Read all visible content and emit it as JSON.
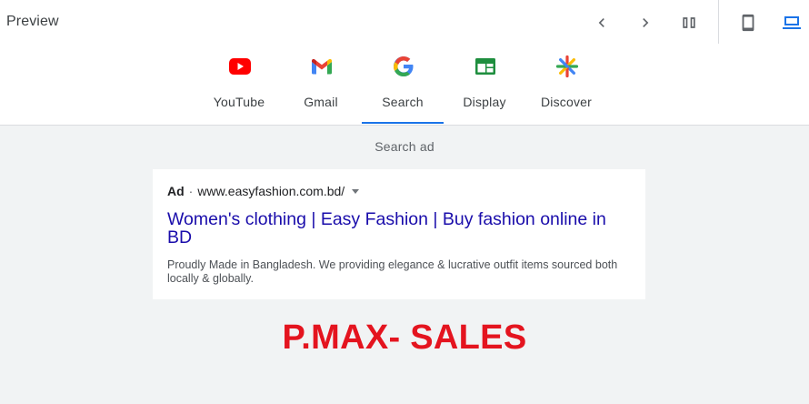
{
  "header": {
    "title": "Preview",
    "icons": [
      "chevron-left-icon",
      "chevron-right-icon",
      "split-view-icon",
      "mobile-icon",
      "desktop-icon"
    ]
  },
  "tabs": [
    {
      "label": "YouTube",
      "icon": "youtube-icon",
      "active": false
    },
    {
      "label": "Gmail",
      "icon": "gmail-icon",
      "active": false
    },
    {
      "label": "Search",
      "icon": "google-icon",
      "active": true
    },
    {
      "label": "Display",
      "icon": "display-icon",
      "active": false
    },
    {
      "label": "Discover",
      "icon": "discover-icon",
      "active": false
    }
  ],
  "preview": {
    "subtitle": "Search ad",
    "ad": {
      "label": "Ad",
      "separator": "·",
      "url": "www.easyfashion.com.bd/",
      "headline": "Women's clothing | Easy Fashion | Buy fashion online in BD",
      "description": "Proudly Made in Bangladesh. We providing elegance & lucrative outfit items sourced both locally & globally."
    }
  },
  "overlay_text": "P.MAX- SALES",
  "colors": {
    "accent": "#1a73e8",
    "headline_link": "#1a0dab",
    "overlay_red": "#e4141f",
    "background": "#f1f3f4"
  }
}
